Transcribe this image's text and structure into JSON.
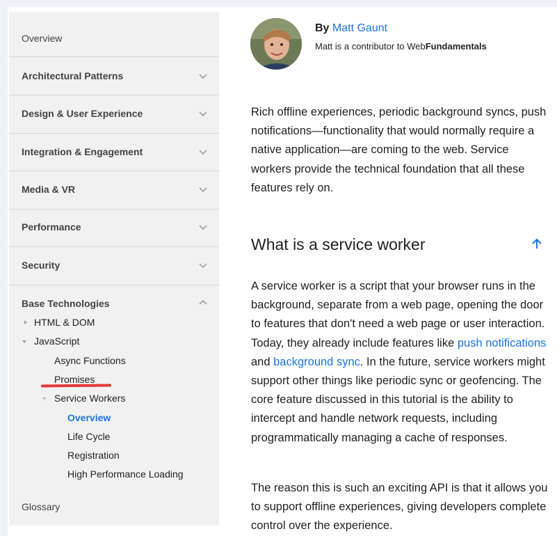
{
  "sidebar": {
    "sections": [
      {
        "label": "Overview"
      },
      {
        "label": "Architectural Patterns"
      },
      {
        "label": "Design & User Experience"
      },
      {
        "label": "Integration & Engagement"
      },
      {
        "label": "Media & VR"
      },
      {
        "label": "Performance"
      },
      {
        "label": "Security"
      },
      {
        "label": "Base Technologies"
      },
      {
        "label": "Glossary"
      }
    ],
    "tree": {
      "html_dom": "HTML & DOM",
      "javascript": "JavaScript",
      "async_functions": "Async Functions",
      "promises": "Promises",
      "service_workers": "Service Workers",
      "overview": "Overview",
      "life_cycle": "Life Cycle",
      "registration": "Registration",
      "high_performance_loading": "High Performance Loading"
    }
  },
  "author": {
    "by": "By",
    "name": "Matt Gaunt",
    "desc_prefix": "Matt is a contributor to Web",
    "desc_brand": "Fundamentals"
  },
  "article": {
    "intro": "Rich offline experiences, periodic background syncs, push notifications—functionality that would normally require a native application—are coming to the web. Service workers provide the technical foundation that all these features rely on.",
    "heading": "What is a service worker",
    "p1_a": "A service worker is a script that your browser runs in the background, separate from a web page, opening the door to features that don't need a web page or user interaction. Today, they already include features like ",
    "p1_link1": "push notifications",
    "p1_and": " and ",
    "p1_link2": "background sync",
    "p1_b": ". In the future, service workers might support other things like periodic sync or geofencing. The core feature discussed in this tutorial is the ability to intercept and handle network requests, including programmatically managing a cache of responses.",
    "p2": "The reason this is such an exciting API is that it allows you to support offline experiences, giving developers complete control over the experience."
  },
  "colors": {
    "accent": "#1a73e8",
    "annotation": "#e53935",
    "sidebar_bg": "#f1f1f1"
  },
  "icons": {
    "chevron": "chevron-down-icon",
    "chevron_up": "chevron-up-icon",
    "tri_right": "triangle-right-icon",
    "tri_down": "triangle-down-icon",
    "back_to_top": "arrow-up-icon"
  }
}
